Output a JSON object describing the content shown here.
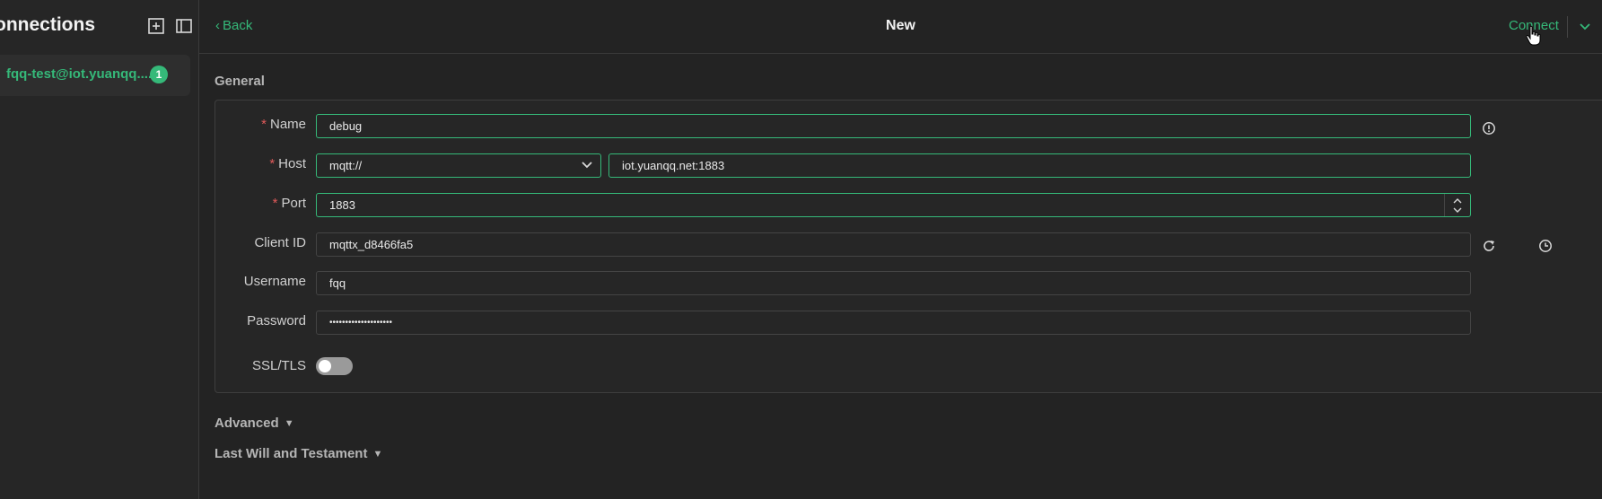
{
  "sidebar": {
    "title": "onnections",
    "connection": {
      "name": "fqq-test@iot.yuanqq....",
      "badge": "1"
    }
  },
  "topbar": {
    "back_label": "Back",
    "back_chevron": "‹",
    "page_title": "New",
    "connect_label": "Connect"
  },
  "general": {
    "section_title": "General",
    "name": {
      "label": "Name",
      "value": "debug"
    },
    "host": {
      "label": "Host",
      "protocol": "mqtt://",
      "value": "iot.yuanqq.net:1883"
    },
    "port": {
      "label": "Port",
      "value": "1883"
    },
    "client_id": {
      "label": "Client ID",
      "value": "mqttx_d8466fa5"
    },
    "username": {
      "label": "Username",
      "value": "fqq"
    },
    "password": {
      "label": "Password",
      "value": "••••••••••••••••••••"
    },
    "ssl": {
      "label": "SSL/TLS",
      "enabled": false
    }
  },
  "required_mark": "*",
  "sections": {
    "advanced": "Advanced",
    "last_will": "Last Will and Testament"
  },
  "colors": {
    "accent": "#35b979",
    "background": "#232323",
    "required": "#e05a5a"
  }
}
